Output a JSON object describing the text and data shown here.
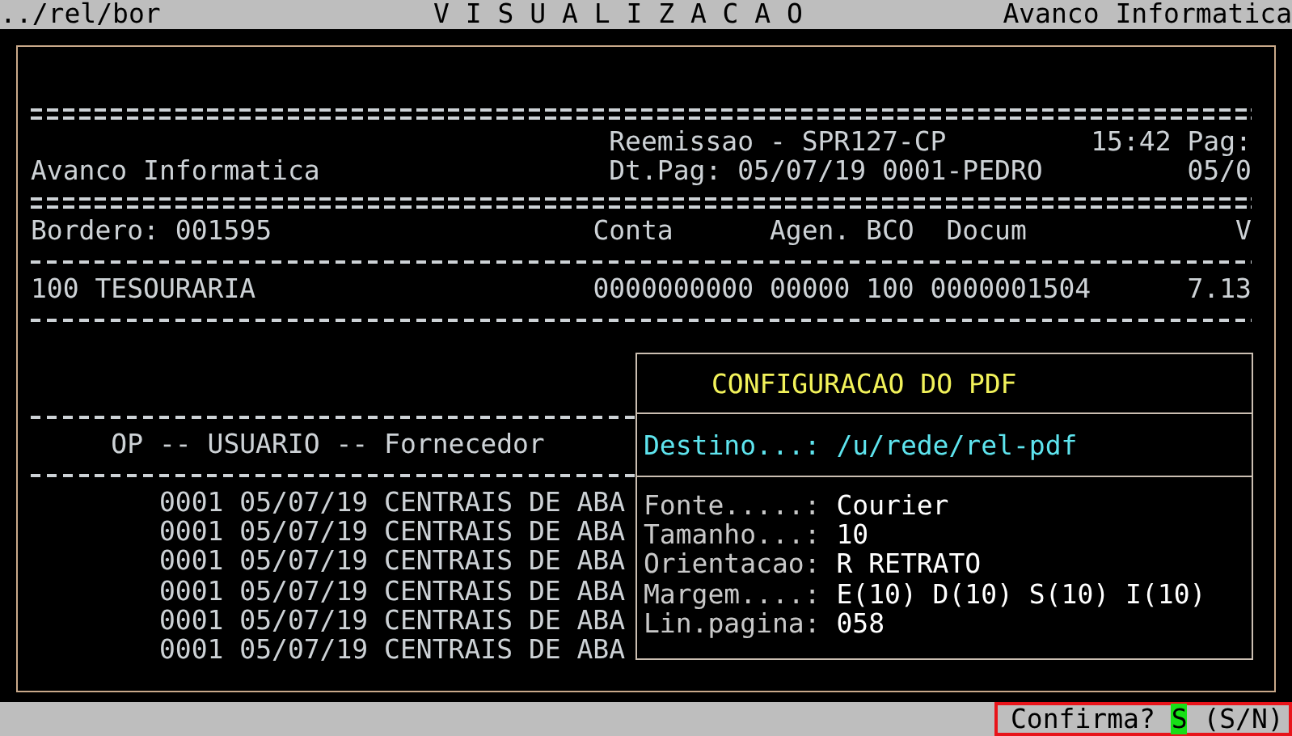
{
  "title_bar": {
    "path": "../rel/bor",
    "title": "V I S U A L I Z A C A O",
    "company": "Avanco Informatica"
  },
  "report": {
    "system": "Reemissao - SPR127-CP",
    "time": "15:42",
    "page_label": "Pag:",
    "company": "Avanco Informatica",
    "payment_date": "Dt.Pag: 05/07/19 0001-PEDRO",
    "page": "05/0",
    "bordero": "Bordero: 001595",
    "columns": [
      "Conta",
      "Agen.",
      "BCO",
      "Docum",
      "V"
    ],
    "rows": [
      {
        "name": "100 TESOURARIA",
        "cells": [
          "0000000000",
          "00000",
          "100",
          "0000001504",
          "7.13"
        ]
      }
    ],
    "detail_header": "OP -- USUARIO -- Fornecedor",
    "detail_rows": [
      {
        "op": "0001",
        "date": "05/07/19",
        "supplier": "CENTRAIS DE ABA"
      },
      {
        "op": "0001",
        "date": "05/07/19",
        "supplier": "CENTRAIS DE ABA"
      },
      {
        "op": "0001",
        "date": "05/07/19",
        "supplier": "CENTRAIS DE ABA"
      },
      {
        "op": "0001",
        "date": "05/07/19",
        "supplier": "CENTRAIS DE ABA"
      },
      {
        "op": "0001",
        "date": "05/07/19",
        "supplier": "CENTRAIS DE ABA"
      },
      {
        "op": "0001",
        "date": "05/07/19",
        "supplier": "CENTRAIS DE ABA"
      }
    ]
  },
  "dialog": {
    "title": "CONFIGURACAO DO PDF",
    "destination": {
      "label": "Destino...:",
      "value": "/u/rede/rel-pdf"
    },
    "fields": [
      {
        "label": "Fonte.....:",
        "value": "Courier"
      },
      {
        "label": "Tamanho...:",
        "value": "10"
      },
      {
        "label": "Orientacao:",
        "value": "R RETRATO"
      },
      {
        "label": "Margem....:",
        "value": "E(10) D(10) S(10) I(10)"
      },
      {
        "label": "Lin.pagina:",
        "value": "058"
      }
    ]
  },
  "status_bar": {
    "prompt": "Confirma?",
    "value": "S",
    "options": "(S/N)"
  }
}
